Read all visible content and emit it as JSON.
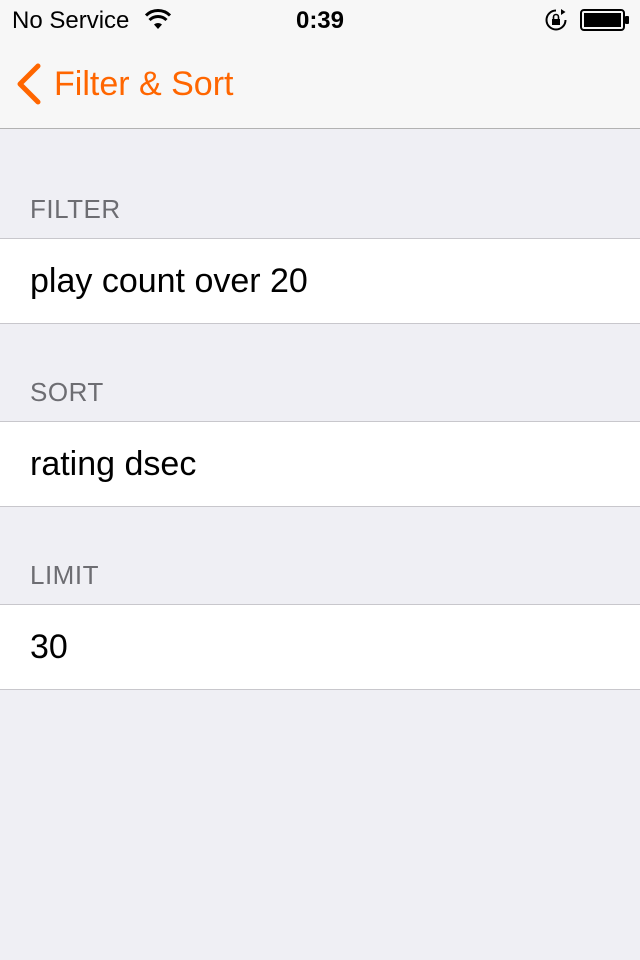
{
  "status_bar": {
    "carrier": "No Service",
    "time": "0:39",
    "icons": [
      "wifi-icon",
      "rotation-lock-icon",
      "battery-icon"
    ]
  },
  "nav": {
    "back_label": "Filter & Sort",
    "accent_color": "#ff6600"
  },
  "sections": [
    {
      "header": "FILTER",
      "value": "play count over 20"
    },
    {
      "header": "SORT",
      "value": "rating dsec"
    },
    {
      "header": "LIMIT",
      "value": "30"
    }
  ]
}
